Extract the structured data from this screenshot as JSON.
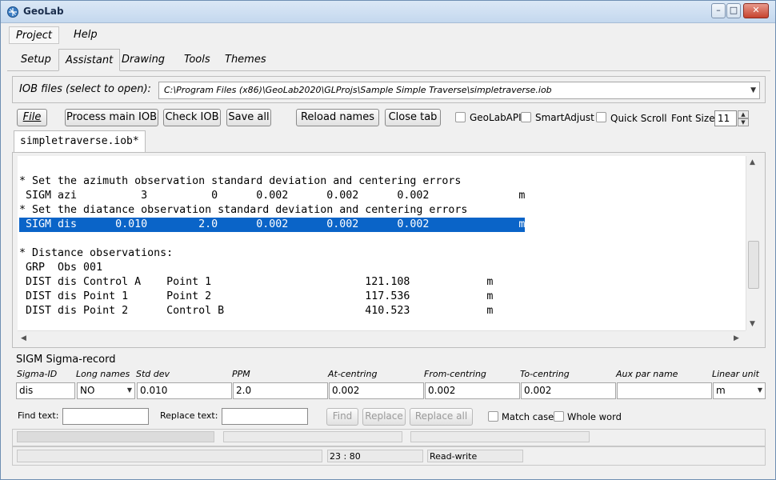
{
  "window": {
    "title": "GeoLab",
    "min_glyph": "–",
    "max_glyph": "□",
    "close_glyph": "✕"
  },
  "menu": {
    "items": [
      "Project",
      "Help"
    ]
  },
  "main_tabs": [
    "Setup",
    "Assistant",
    "Drawing",
    "Tools",
    "Themes"
  ],
  "iob": {
    "label": "IOB files (select to open):",
    "path": "C:\\Program Files (x86)\\GeoLab2020\\GLProjs\\Sample Simple Traverse\\simpletraverse.iob",
    "arrow": "▼"
  },
  "toolbar": {
    "file": "File",
    "process_main": "Process main IOB",
    "check": "Check IOB",
    "save_all": "Save all",
    "reload_names": "Reload names",
    "close_tab": "Close tab",
    "geolabapi": "GeoLabAPI",
    "smartadjust": "SmartAdjust",
    "quick_scroll": "Quick Scroll",
    "font_size_label": "Font Size:",
    "font_size_value": "11",
    "spin_up": "▲",
    "spin_down": "▼"
  },
  "file_tab": "simpletraverse.iob*",
  "editor": {
    "lines": [
      "* Set the azimuth observation standard deviation and centering errors",
      " SIGM azi          3          0      0.002      0.002      0.002              m",
      "* Set the diatance observation standard deviation and centering errors",
      " SIGM dis      0.010        2.0      0.002      0.002      0.002              m",
      "",
      "* Distance observations:",
      " GRP  Obs 001",
      " DIST dis Control A    Point 1                        121.108            m",
      " DIST dis Point 1      Point 2                        117.536            m",
      " DIST dis Point 2      Control B                      410.523            m"
    ],
    "selected_line": 3,
    "scroll_up": "▲",
    "scroll_down": "▼",
    "scroll_left": "◀",
    "scroll_right": "▶"
  },
  "sigm": {
    "title": "SIGM Sigma-record",
    "headers": [
      "Sigma-ID",
      "Long names",
      "Std dev",
      "PPM",
      "At-centring",
      "From-centring",
      "To-centring",
      "Aux par name",
      "Linear unit"
    ],
    "values": [
      "dis",
      "NO",
      "0.010",
      "2.0",
      "0.002",
      "0.002",
      "0.002",
      "",
      "m"
    ],
    "arrow": "▼"
  },
  "find": {
    "find_label": "Find text:",
    "replace_label": "Replace text:",
    "find_btn": "Find",
    "replace_btn": "Replace",
    "replace_all_btn": "Replace all",
    "match_case": "Match case",
    "whole_word": "Whole word"
  },
  "status": {
    "position": "23 : 80",
    "mode": "Read-write"
  }
}
